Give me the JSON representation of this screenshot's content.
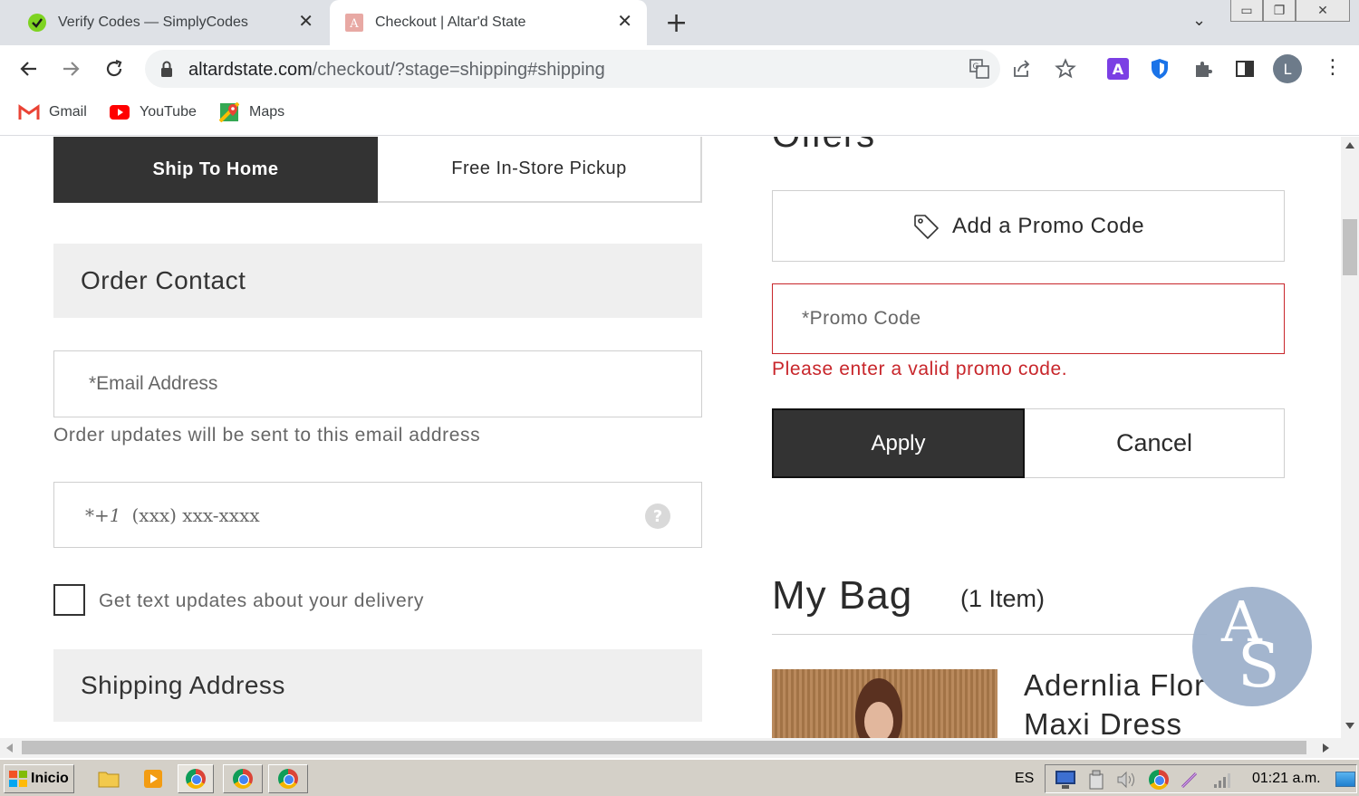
{
  "browser": {
    "tabs": [
      {
        "title": "Verify Codes — SimplyCodes",
        "active": false
      },
      {
        "title": "Checkout | Altar'd State",
        "active": true
      }
    ],
    "new_tab": "+",
    "url_domain": "altardstate.com",
    "url_path": "/checkout/?stage=shipping#shipping",
    "profile_initial": "L",
    "extension_letter": "A",
    "bookmarks": [
      {
        "label": "Gmail",
        "icon": "gmail-icon"
      },
      {
        "label": "YouTube",
        "icon": "youtube-icon"
      },
      {
        "label": "Maps",
        "icon": "maps-icon"
      }
    ]
  },
  "delivery": {
    "ship_to_home": "Ship To Home",
    "store_pickup": "Free In-Store Pickup"
  },
  "order_contact": {
    "heading": "Order Contact",
    "email_placeholder": "*Email Address",
    "email_hint": "Order updates will be sent to this email address",
    "phone_prefix": "*+1",
    "phone_placeholder": "(xxx) xxx-xxxx",
    "help": "?",
    "sms_checkbox_label": "Get text updates about your delivery",
    "sms_checked": false
  },
  "shipping_address": {
    "heading": "Shipping Address"
  },
  "offers": {
    "heading": "Offers",
    "add_promo": "Add a Promo Code",
    "promo_placeholder": "*Promo Code",
    "promo_error": "Please enter a valid promo code.",
    "apply": "Apply",
    "cancel": "Cancel"
  },
  "bag": {
    "heading": "My Bag",
    "count": "(1 Item)",
    "item_line1": "Adernlia Flor",
    "item_line2": "Maxi Dress",
    "logo_letters": [
      "A",
      "S"
    ]
  },
  "taskbar": {
    "start": "Inicio",
    "language": "ES",
    "clock": "01:21 a.m."
  },
  "colors": {
    "dark_button": "#333333",
    "error_red": "#c8262b",
    "logo_blue": "#9fb2cc",
    "tab_strip": "#dee1e6"
  }
}
